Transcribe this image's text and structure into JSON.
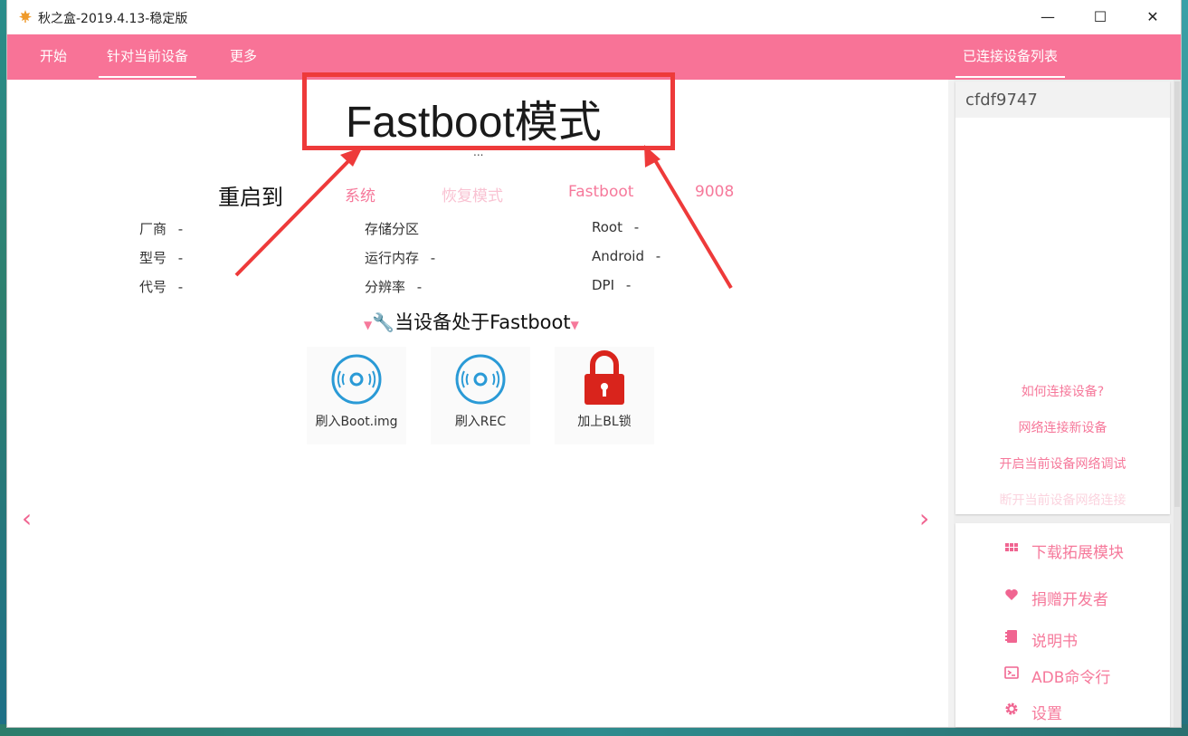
{
  "window": {
    "title": "秋之盒-2019.4.13-稳定版",
    "minimize": "—",
    "maximize": "☐",
    "close": "✕"
  },
  "nav": {
    "tabs": [
      {
        "label": "开始"
      },
      {
        "label": "针对当前设备",
        "active": true
      },
      {
        "label": "更多"
      }
    ],
    "right_tab": "已连接设备列表"
  },
  "main": {
    "mode_title": "Fastboot模式",
    "ellipsis": "...",
    "reboot": {
      "label": "重启到",
      "options": [
        {
          "label": "系统",
          "enabled": true
        },
        {
          "label": "恢复模式",
          "enabled": false
        },
        {
          "label": "Fastboot",
          "enabled": true
        },
        {
          "label": "9008",
          "enabled": true
        }
      ]
    },
    "info": {
      "manufacturer": {
        "label": "厂商",
        "value": "-"
      },
      "model": {
        "label": "型号",
        "value": "-"
      },
      "codename": {
        "label": "代号",
        "value": "-"
      },
      "storage": {
        "label": "存储分区",
        "value": ""
      },
      "ram": {
        "label": "运行内存",
        "value": "-"
      },
      "resolution": {
        "label": "分辨率",
        "value": "-"
      },
      "root": {
        "label": "Root",
        "value": "-"
      },
      "android": {
        "label": "Android",
        "value": "-"
      },
      "dpi": {
        "label": "DPI",
        "value": "-"
      }
    },
    "section_title": "当设备处于Fastboot",
    "actions": [
      {
        "label": "刷入Boot.img",
        "icon": "disc-icon"
      },
      {
        "label": "刷入REC",
        "icon": "disc-icon"
      },
      {
        "label": "加上BL锁",
        "icon": "lock-icon"
      }
    ],
    "prev": "‹",
    "next": "›"
  },
  "side": {
    "devices": [
      "cfdf9747"
    ],
    "links": [
      {
        "label": "如何连接设备?",
        "enabled": true
      },
      {
        "label": "网络连接新设备",
        "enabled": true
      },
      {
        "label": "开启当前设备网络调试",
        "enabled": true
      },
      {
        "label": "断开当前设备网络连接",
        "enabled": false
      }
    ],
    "menu": [
      {
        "label": "下载拓展模块",
        "icon": "grid-icon"
      },
      {
        "label": "捐赠开发者",
        "icon": "heart-icon"
      },
      {
        "label": "说明书",
        "icon": "book-icon"
      },
      {
        "label": "ADB命令行",
        "icon": "terminal-icon"
      },
      {
        "label": "设置",
        "icon": "gear-icon"
      }
    ]
  },
  "colors": {
    "accent": "#f87397",
    "link": "#f6799b",
    "annotation": "#ee3a3a",
    "lock": "#d9241c",
    "disc": "#2a9ad6"
  }
}
